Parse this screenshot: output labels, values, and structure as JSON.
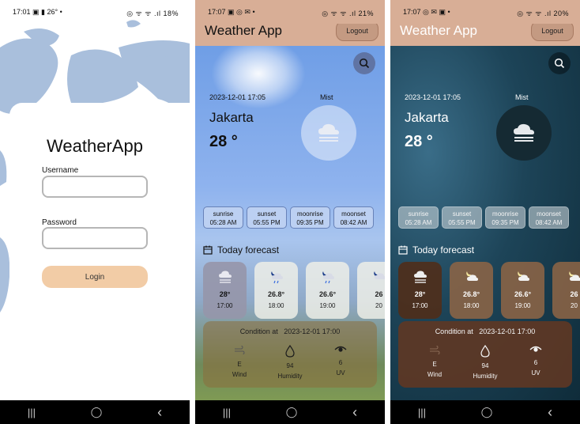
{
  "screens": [
    {
      "status": {
        "time": "17:01",
        "left_icons": "▣ ▮ 26° •",
        "right_icons": "◎ ᯤ ᯤ .ıl 18%"
      },
      "login": {
        "title": "WeatherApp",
        "username_label": "Username",
        "username_value": "",
        "password_label": "Password",
        "password_value": "",
        "login_button": "Login"
      }
    },
    {
      "status": {
        "time": "17:07",
        "left_icons": "▣ ◎ ✉ •",
        "right_icons": "◎ ᯤ ᯤ .ıl 21%"
      },
      "app_title": "Weather App",
      "logout_label": "Logout",
      "datetime": "2023-12-01 17:05",
      "condition": "Mist",
      "city": "Jakarta",
      "temperature": "28 °",
      "astro": [
        {
          "label": "sunrise",
          "value": "05:28 AM"
        },
        {
          "label": "sunset",
          "value": "05:55 PM"
        },
        {
          "label": "moonrise",
          "value": "09:35 PM"
        },
        {
          "label": "moonset",
          "value": "08:42 AM"
        }
      ],
      "forecast_title": "Today forecast",
      "hourly": [
        {
          "temp": "28°",
          "time": "17:00",
          "icon": "mist-icon"
        },
        {
          "temp": "26.8°",
          "time": "18:00",
          "icon": "moon-rain-icon"
        },
        {
          "temp": "26.6°",
          "time": "19:00",
          "icon": "moon-rain-icon"
        },
        {
          "temp": "26",
          "time": "20",
          "icon": "moon-rain-icon"
        }
      ],
      "current": {
        "label": "Condition at",
        "datetime": "2023-12-01 17:00",
        "wind_value": "E",
        "wind_label": "Wind",
        "humidity_value": "94",
        "humidity_label": "Humidity",
        "uv_value": "6",
        "uv_label": "UV"
      }
    },
    {
      "status": {
        "time": "17:07",
        "left_icons": "◎ ✉ ▣ •",
        "right_icons": "◎ ᯤ ᯤ .ıl 20%"
      },
      "app_title": "Weather App",
      "logout_label": "Logout",
      "datetime": "2023-12-01 17:05",
      "condition": "Mist",
      "city": "Jakarta",
      "temperature": "28 °",
      "astro": [
        {
          "label": "sunrise",
          "value": "05:28 AM"
        },
        {
          "label": "sunset",
          "value": "05:55 PM"
        },
        {
          "label": "moonrise",
          "value": "09:35 PM"
        },
        {
          "label": "moonset",
          "value": "08:42 AM"
        }
      ],
      "forecast_title": "Today forecast",
      "hourly": [
        {
          "temp": "28°",
          "time": "17:00",
          "icon": "mist-icon"
        },
        {
          "temp": "26.8°",
          "time": "18:00",
          "icon": "moon-cloud-icon"
        },
        {
          "temp": "26.6°",
          "time": "19:00",
          "icon": "moon-cloud-icon"
        },
        {
          "temp": "26",
          "time": "20",
          "icon": "moon-cloud-icon"
        }
      ],
      "current": {
        "label": "Condition at",
        "datetime": "2023-12-01 17:00",
        "wind_value": "E",
        "wind_label": "Wind",
        "humidity_value": "94",
        "humidity_label": "Humidity",
        "uv_value": "6",
        "uv_label": "UV"
      }
    }
  ],
  "nav": {
    "recents": "|||",
    "home": "◯",
    "back": "‹"
  },
  "colors": {
    "appbar": "#d8ae96",
    "login_button": "#f2cca6",
    "map_land": "#a9bfdc",
    "day_sky": "#6f9ee6",
    "night_sky": "#0f2c3a"
  }
}
